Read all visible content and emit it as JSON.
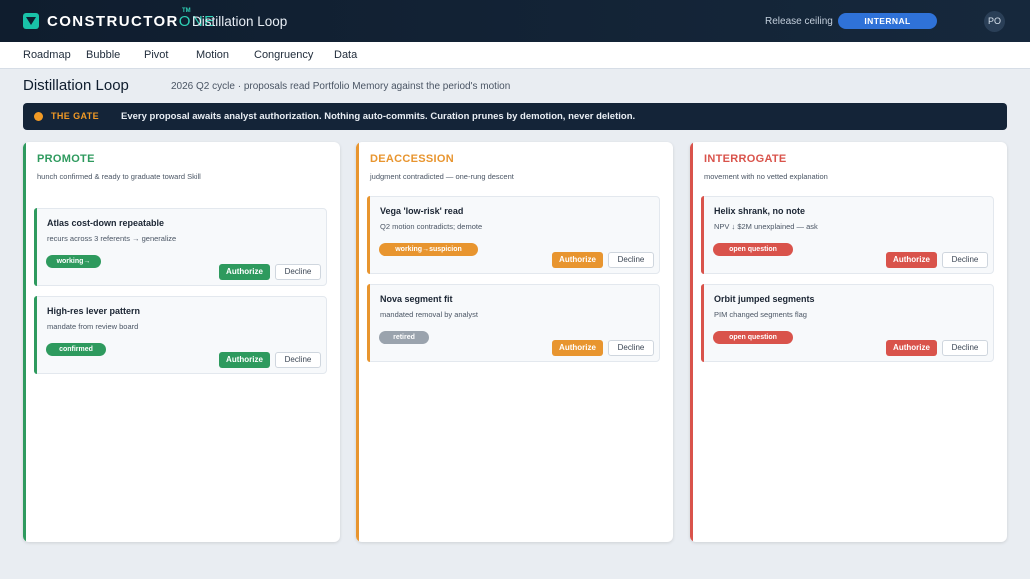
{
  "header": {
    "brand_main": "CONSTRUCTOR",
    "brand_accent": "ONE",
    "brand_tm": "TM",
    "app_title": "Distillation Loop",
    "ceiling_label": "Release ceiling",
    "ceiling_value": "INTERNAL",
    "avatar_initials": "PO",
    "logo_icon": "constructor-one-logo-icon"
  },
  "nav": {
    "items": [
      "Roadmap",
      "Bubble",
      "Pivot",
      "Motion",
      "Congruency",
      "Data"
    ]
  },
  "page": {
    "title": "Distillation Loop",
    "subtitle": "2026 Q2 cycle · proposals read Portfolio Memory against the period's motion"
  },
  "gate": {
    "label": "THE GATE",
    "text": "Every proposal awaits analyst authorization. Nothing auto-commits. Curation prunes by demotion, never deletion.",
    "accent": "#f29a25"
  },
  "columns": [
    {
      "title": "PROMOTE",
      "description": "hunch confirmed & ready to graduate toward Skill",
      "color": "#2e9a5e",
      "cards": [
        {
          "title": "Atlas cost-down repeatable",
          "meta": "recurs across 3 referents → generalize",
          "tag": "working→",
          "tag_color": "#2e9a5e",
          "authorize": "Authorize",
          "decline": "Decline"
        },
        {
          "title": "High-res lever pattern",
          "meta": "mandate from review board",
          "tag": "confirmed",
          "tag_color": "#2e9a5e",
          "authorize": "Authorize",
          "decline": "Decline"
        }
      ]
    },
    {
      "title": "DEACCESSION",
      "description": "judgment contradicted — one-rung descent",
      "color": "#e8952f",
      "cards": [
        {
          "title": "Vega 'low-risk' read",
          "meta": "Q2 motion contradicts; demote",
          "tag": "working→suspicion",
          "tag_color": "#e8952f",
          "authorize": "Authorize",
          "decline": "Decline"
        },
        {
          "title": "Nova segment fit",
          "meta": "mandated removal by analyst",
          "tag": "retired",
          "tag_color": "#9aa3ad",
          "authorize": "Authorize",
          "decline": "Decline"
        }
      ]
    },
    {
      "title": "INTERROGATE",
      "description": "movement with no vetted explanation",
      "color": "#d9534b",
      "cards": [
        {
          "title": "Helix shrank, no note",
          "meta": "NPV ↓ $2M unexplained — ask",
          "tag": "open question",
          "tag_color": "#d9534b",
          "authorize": "Authorize",
          "decline": "Decline"
        },
        {
          "title": "Orbit jumped segments",
          "meta": "PIM changed segments flag",
          "tag": "open question",
          "tag_color": "#d9534b",
          "authorize": "Authorize",
          "decline": "Decline"
        }
      ]
    }
  ]
}
